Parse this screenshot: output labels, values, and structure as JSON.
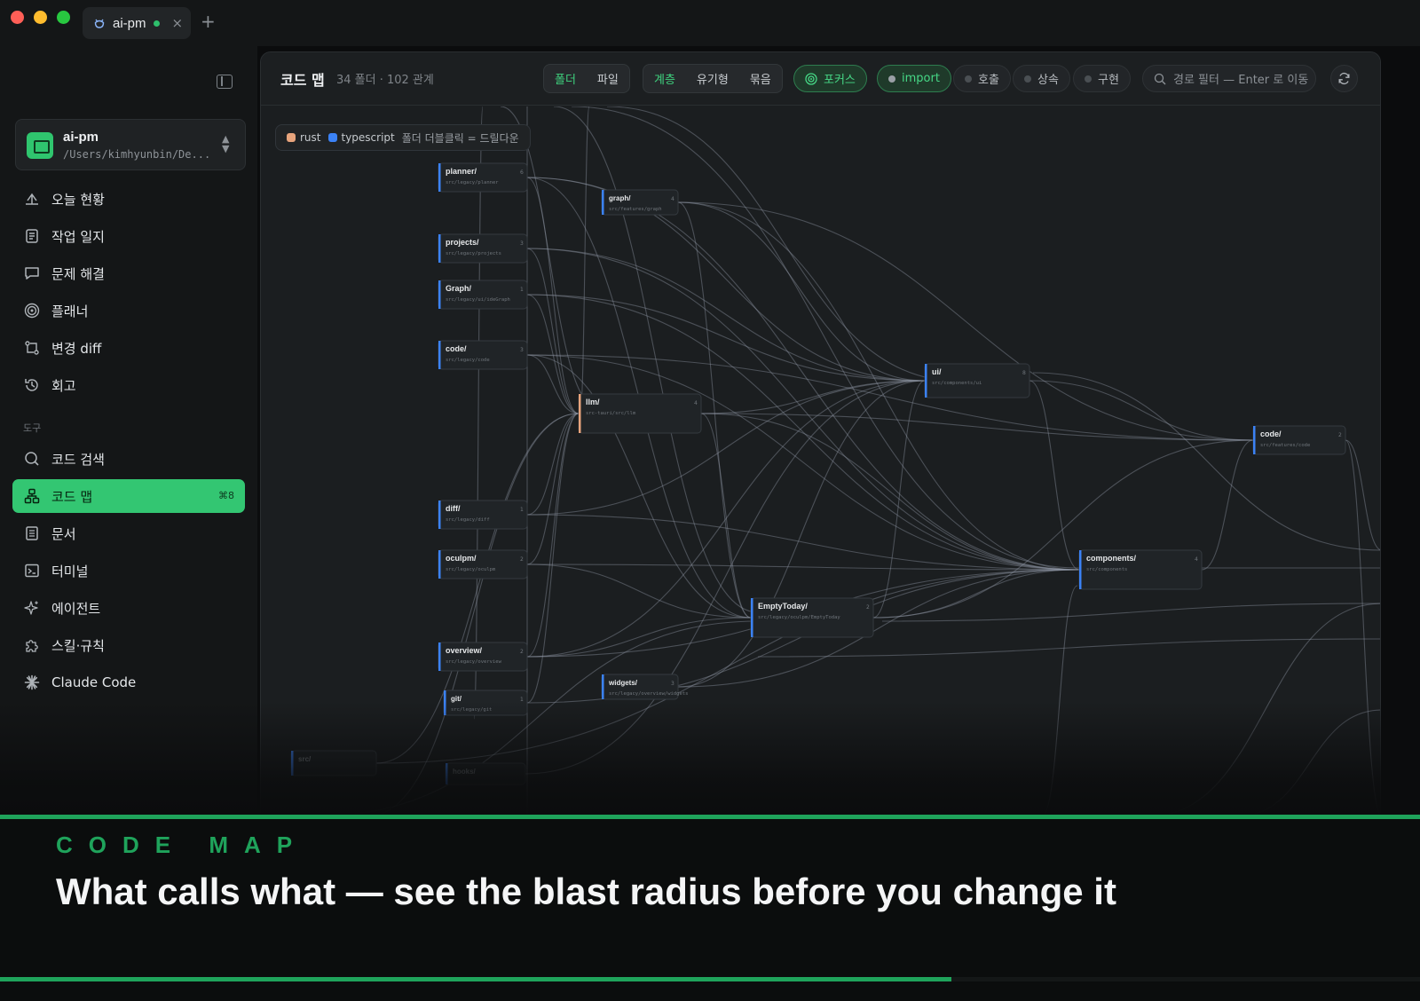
{
  "window": {
    "tab_label": "ai-pm",
    "tab_close": "×",
    "new_tab": "+"
  },
  "sidebar": {
    "project": {
      "name": "ai-pm",
      "path": "/Users/kimhyunbin/De..."
    },
    "items": [
      {
        "label": "오늘 현황",
        "icon": "dashboard-icon"
      },
      {
        "label": "작업 일지",
        "icon": "journal-icon"
      },
      {
        "label": "문제 해결",
        "icon": "chat-icon"
      },
      {
        "label": "플래너",
        "icon": "target-icon"
      },
      {
        "label": "변경 diff",
        "icon": "diff-icon"
      },
      {
        "label": "회고",
        "icon": "history-icon"
      }
    ],
    "tools_label": "도구",
    "tools": [
      {
        "label": "코드 검색",
        "icon": "search-icon"
      },
      {
        "label": "코드 맵",
        "icon": "code-map-icon",
        "shortcut": "⌘8",
        "active": true
      },
      {
        "label": "문서",
        "icon": "document-icon"
      },
      {
        "label": "터미널",
        "icon": "terminal-icon"
      },
      {
        "label": "에이전트",
        "icon": "sparkle-icon"
      },
      {
        "label": "스킬·규칙",
        "icon": "puzzle-icon"
      },
      {
        "label": "Claude Code",
        "icon": "claude-icon"
      }
    ]
  },
  "toolbar": {
    "title": "코드 맵",
    "subtitle": "34 폴더 · 102 관계",
    "view_modes": [
      "폴더",
      "파일"
    ],
    "layouts": [
      "계층",
      "유기형",
      "묶음"
    ],
    "focus_label": "포커스",
    "filters": [
      {
        "label": "import",
        "on": true
      },
      {
        "label": "호출",
        "on": false
      },
      {
        "label": "상속",
        "on": false
      },
      {
        "label": "구현",
        "on": false
      }
    ],
    "search_placeholder": "경로 필터 — Enter 로 이동"
  },
  "legend": {
    "items": [
      {
        "label": "rust",
        "color": "#e8a47c"
      },
      {
        "label": "typescript",
        "color": "#3b82f6"
      }
    ],
    "hint": "폴더 더블클릭 = 드릴다운"
  },
  "graph": {
    "nodes": [
      {
        "id": "planner",
        "label": "planner/",
        "path": "src/legacy/planner",
        "count": "6"
      },
      {
        "id": "projects",
        "label": "projects/",
        "path": "src/legacy/projects",
        "count": "3"
      },
      {
        "id": "Graph",
        "label": "Graph/",
        "path": "src/legacy/ui/ideGraph",
        "count": "1"
      },
      {
        "id": "code1",
        "label": "code/",
        "path": "src/legacy/code",
        "count": "3"
      },
      {
        "id": "graph",
        "label": "graph/",
        "path": "src/features/graph",
        "count": "4"
      },
      {
        "id": "llm",
        "label": "llm/",
        "path": "src-tauri/src/llm",
        "count": "4"
      },
      {
        "id": "ui",
        "label": "ui/",
        "path": "src/components/ui",
        "count": "8"
      },
      {
        "id": "code2",
        "label": "code/",
        "path": "src/features/code",
        "count": "2"
      },
      {
        "id": "diff",
        "label": "diff/",
        "path": "src/legacy/diff",
        "count": "1"
      },
      {
        "id": "oculpm",
        "label": "oculpm/",
        "path": "src/legacy/oculpm",
        "count": "2"
      },
      {
        "id": "components",
        "label": "components/",
        "path": "src/components",
        "count": "4"
      },
      {
        "id": "EmptyToday",
        "label": "EmptyToday/",
        "path": "src/legacy/oculpm/EmptyToday",
        "count": "2"
      },
      {
        "id": "overview",
        "label": "overview/",
        "path": "src/legacy/overview",
        "count": "2"
      },
      {
        "id": "widgets",
        "label": "widgets/",
        "path": "src/legacy/overview/widgets",
        "count": "3"
      },
      {
        "id": "git",
        "label": "git/",
        "path": "src/legacy/git",
        "count": "1"
      },
      {
        "id": "src",
        "label": "src/",
        "path": "",
        "count": ""
      },
      {
        "id": "hooks",
        "label": "hooks/",
        "path": "",
        "count": ""
      }
    ]
  },
  "caption": {
    "kicker": "CODE MAP",
    "headline": "What calls what — see the blast radius before you change it",
    "progress": 0.67
  },
  "colors": {
    "accent": "#33c672",
    "caption_accent": "#1fa35b",
    "background": "#1b1e20"
  }
}
